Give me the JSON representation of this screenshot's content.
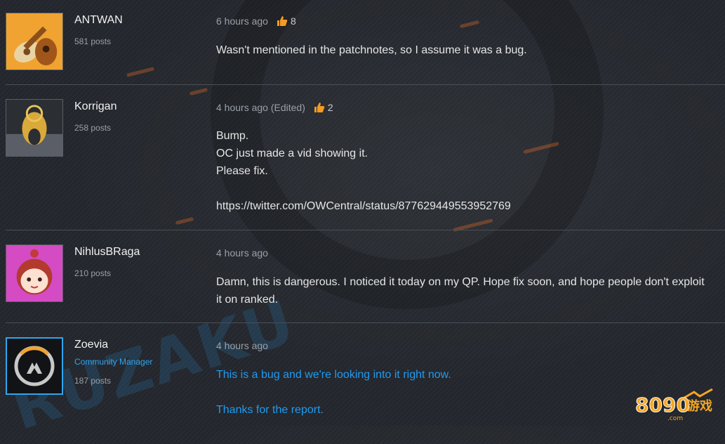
{
  "posts": [
    {
      "username": "ANTWAN",
      "posts_count": "581 posts",
      "time": "6 hours ago",
      "likes": "8",
      "body": [
        "Wasn't mentioned in the patchnotes, so I assume it was a bug."
      ]
    },
    {
      "username": "Korrigan",
      "posts_count": "258 posts",
      "time": "4 hours ago (Edited)",
      "likes": "2",
      "body": [
        "Bump.",
        "OC just made a vid showing it.",
        "Please fix.",
        "",
        "https://twitter.com/OWCentral/status/877629449553952769"
      ]
    },
    {
      "username": "NihlusBRaga",
      "posts_count": "210 posts",
      "time": "4 hours ago",
      "body": [
        "Damn, this is dangerous. I noticed it today on my QP. Hope fix soon, and hope people don't exploit it on ranked."
      ]
    },
    {
      "username": "Zoevia",
      "role": "Community Manager",
      "posts_count": "187 posts",
      "time": "4 hours ago",
      "body": [
        "This is a bug and we're looking into it right now.",
        "",
        "Thanks for the report."
      ]
    }
  ],
  "watermark": {
    "logo_text": "8090",
    "logo_cn": "游戏",
    "logo_domain": ".com",
    "bg_text": "RUZAKU"
  },
  "colors": {
    "accent_blue": "#1f9bf0",
    "like_orange": "#f59a23",
    "background": "#23262c"
  }
}
